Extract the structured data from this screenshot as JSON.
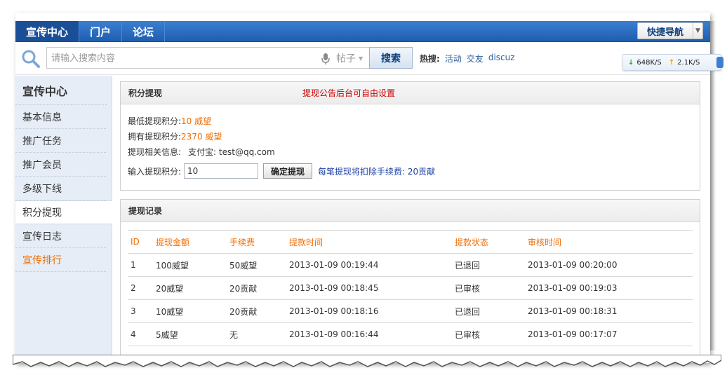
{
  "topnav": {
    "items": [
      {
        "label": "宣传中心",
        "active": true
      },
      {
        "label": "门户",
        "active": false
      },
      {
        "label": "论坛",
        "active": false
      }
    ],
    "quick_nav": "快捷导航"
  },
  "search": {
    "placeholder": "请输入搜索内容",
    "type": "帖子",
    "button": "搜索",
    "hot_label": "热搜:",
    "hot_links": [
      "活动",
      "交友",
      "discuz"
    ]
  },
  "speed": {
    "down": "648K/S",
    "up": "2.1K/S"
  },
  "sidebar": {
    "title": "宣传中心",
    "items": [
      {
        "label": "基本信息",
        "active": false,
        "highlight": false
      },
      {
        "label": "推广任务",
        "active": false,
        "highlight": false
      },
      {
        "label": "推广会员",
        "active": false,
        "highlight": false
      },
      {
        "label": "多级下线",
        "active": false,
        "highlight": false
      },
      {
        "label": "积分提现",
        "active": true,
        "highlight": false
      },
      {
        "label": "宣传日志",
        "active": false,
        "highlight": false
      },
      {
        "label": "宣传排行",
        "active": false,
        "highlight": true
      }
    ]
  },
  "withdraw": {
    "title": "积分提现",
    "notice": "提现公告后台可自由设置",
    "min_label": "最低提现积分:",
    "min_value": "10 威望",
    "have_label": "拥有提现积分:",
    "have_value": "2370 威望",
    "info_label": "提现相关信息:",
    "info_value": "支付宝: test@qq.com",
    "input_label": "输入提现积分:",
    "input_value": "10",
    "confirm": "确定提现",
    "fee_note": "每笔提现将扣除手续费: 20贡献"
  },
  "records": {
    "title": "提现记录",
    "columns": [
      "ID",
      "提现金额",
      "手续费",
      "提款时间",
      "提款状态",
      "审核时间"
    ],
    "rows": [
      [
        "1",
        "100威望",
        "50威望",
        "2013-01-09 00:19:44",
        "已退回",
        "2013-01-09 00:20:00"
      ],
      [
        "2",
        "20威望",
        "20贡献",
        "2013-01-09 00:18:45",
        "已审核",
        "2013-01-09 00:19:03"
      ],
      [
        "3",
        "10威望",
        "20贡献",
        "2013-01-09 00:18:16",
        "已退回",
        "2013-01-09 00:18:31"
      ],
      [
        "4",
        "5威望",
        "无",
        "2013-01-09 00:16:44",
        "已审核",
        "2013-01-09 00:17:07"
      ]
    ]
  },
  "colors": {
    "nav_blue": "#1f5eb0",
    "accent_orange": "#f26c00",
    "notice_red": "#cc0000",
    "note_blue": "#1a3fa6"
  }
}
